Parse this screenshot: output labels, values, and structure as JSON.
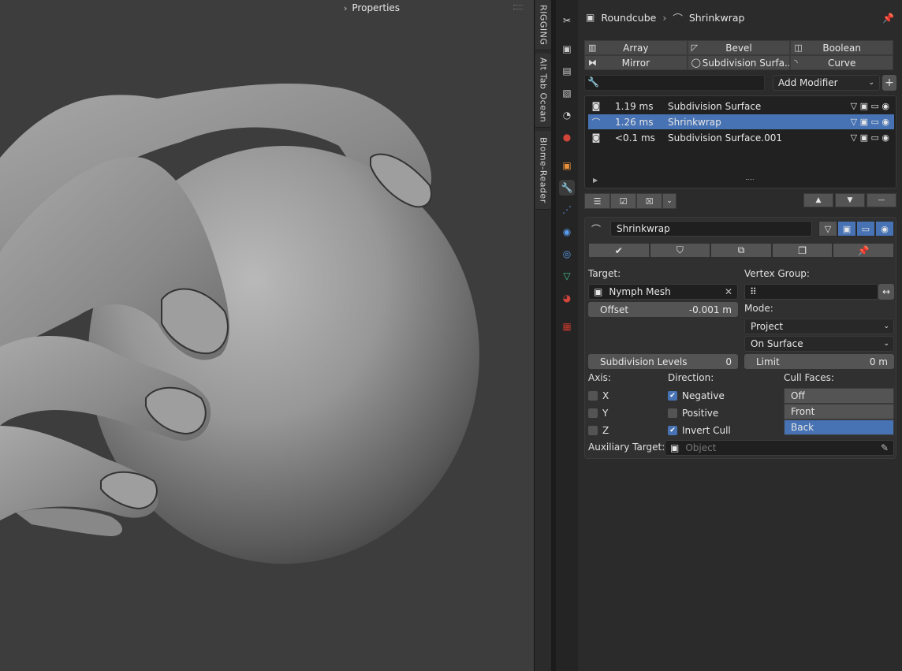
{
  "viewport": {
    "header_label": "Properties"
  },
  "sidebar_tabs": [
    "RIGGING",
    "Alt Tab Ocean",
    "Blome-Reader"
  ],
  "properties": {
    "breadcrumb": {
      "object": "Roundcube",
      "modifier": "Shrinkwrap"
    },
    "modifier_buttons": [
      "Array",
      "Bevel",
      "Boolean",
      "Mirror",
      "Subdivision Surfa...",
      "Curve"
    ],
    "search_placeholder": "",
    "add_modifier_label": "Add Modifier",
    "modifier_stack": [
      {
        "time": "1.19 ms",
        "name": "Subdivision Surface",
        "selected": false
      },
      {
        "time": "1.26 ms",
        "name": "Shrinkwrap",
        "selected": true
      },
      {
        "time": "<0.1 ms",
        "name": "Subdivision Surface.001",
        "selected": false
      }
    ],
    "panel": {
      "name": "Shrinkwrap",
      "target_label": "Target:",
      "target_value": "Nymph Mesh",
      "vertex_group_label": "Vertex Group:",
      "vertex_group_value": "",
      "offset_label": "Offset",
      "offset_value": "-0.001 m",
      "mode_label": "Mode:",
      "mode_value": "Project",
      "snap_mode_value": "On Surface",
      "subdiv_label": "Subdivision Levels",
      "subdiv_value": "0",
      "limit_label": "Limit",
      "limit_value": "0 m",
      "axis_label": "Axis:",
      "axes": [
        {
          "label": "X",
          "checked": false
        },
        {
          "label": "Y",
          "checked": false
        },
        {
          "label": "Z",
          "checked": false
        }
      ],
      "direction_label": "Direction:",
      "directions": [
        {
          "label": "Negative",
          "checked": true
        },
        {
          "label": "Positive",
          "checked": false
        },
        {
          "label": "Invert Cull",
          "checked": true
        }
      ],
      "cull_label": "Cull Faces:",
      "cull_options": [
        "Off",
        "Front",
        "Back"
      ],
      "cull_selected": "Back",
      "aux_label": "Auxiliary Target:",
      "aux_placeholder": "Object"
    }
  },
  "colors": {
    "accent": "#4772b3",
    "panel_bg": "#2b2b2b",
    "viewport_bg": "#3d3d3d"
  }
}
